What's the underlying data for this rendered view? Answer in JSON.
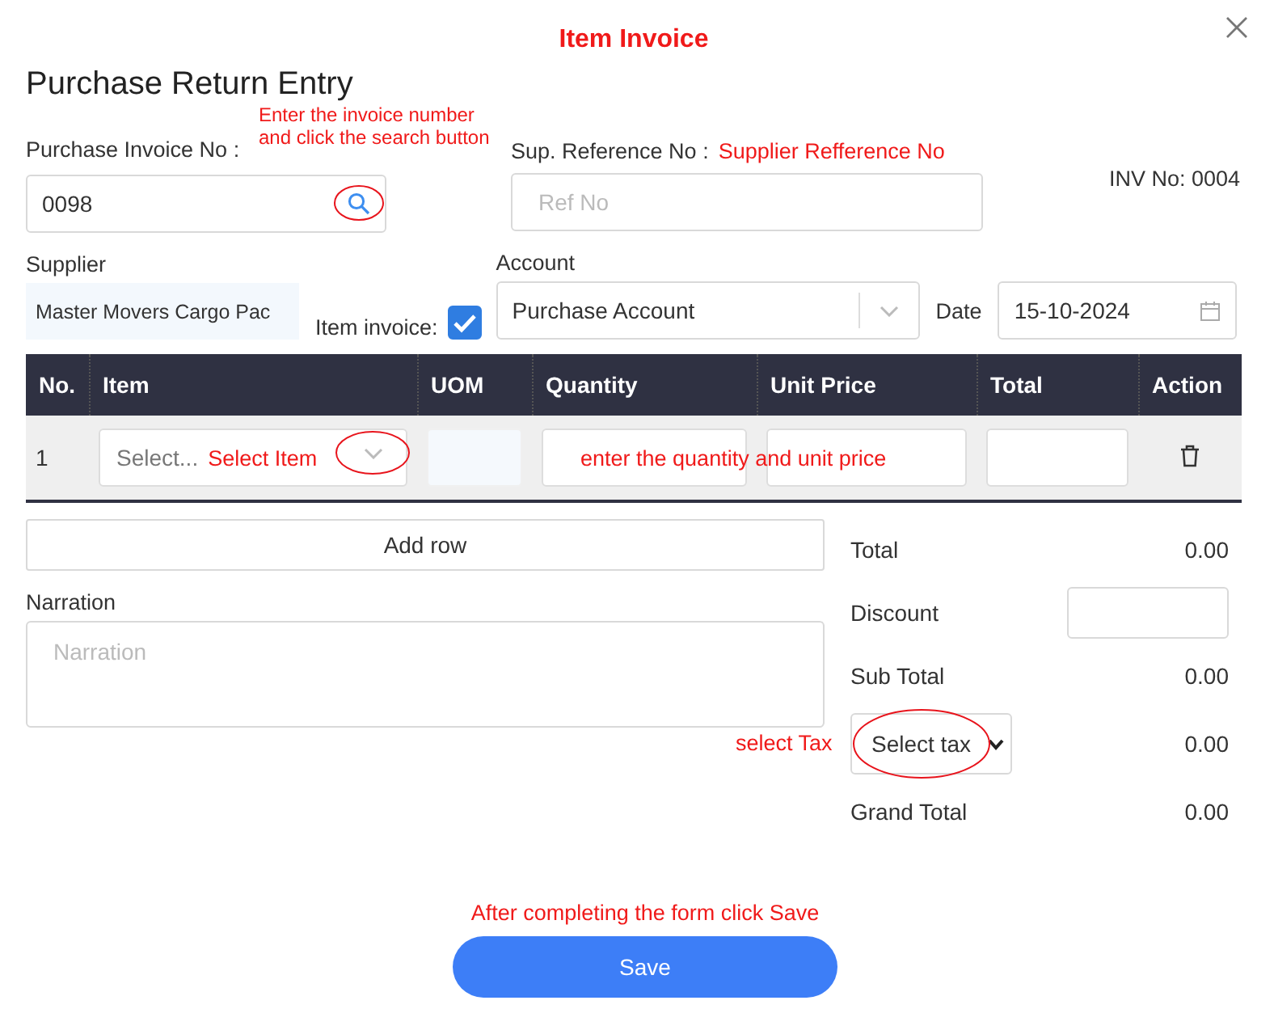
{
  "dialog": {
    "heading": "Item Invoice",
    "title": "Purchase Return Entry"
  },
  "fields": {
    "purchase_invoice_no": {
      "label": "Purchase Invoice No :",
      "value": "0098"
    },
    "sup_reference_no": {
      "label": "Sup. Reference No :",
      "placeholder": "Ref No"
    },
    "inv_no": "INV No: 0004",
    "supplier": {
      "label": "Supplier",
      "value": "Master Movers Cargo Pac"
    },
    "item_invoice": {
      "label": "Item invoice:",
      "checked": true
    },
    "account": {
      "label": "Account",
      "value": "Purchase Account"
    },
    "date": {
      "label": "Date",
      "value": "15-10-2024"
    }
  },
  "table": {
    "columns": [
      "No.",
      "Item",
      "UOM",
      "Quantity",
      "Unit Price",
      "Total",
      "Action"
    ],
    "rows": [
      {
        "no": "1",
        "item_placeholder": "Select..."
      }
    ]
  },
  "add_row": "Add row",
  "narration": {
    "label": "Narration",
    "placeholder": "Narration"
  },
  "summary": [
    {
      "kind": "value",
      "label": "Total",
      "value": "0.00"
    },
    {
      "kind": "input",
      "label": "Discount"
    },
    {
      "kind": "value",
      "label": "Sub Total",
      "value": "0.00"
    },
    {
      "kind": "select",
      "placeholder": "Select tax",
      "value": "0.00"
    },
    {
      "kind": "value",
      "label": "Grand Total",
      "value": "0.00"
    }
  ],
  "save": "Save",
  "annotations": {
    "invoice_search": "Enter the invoice number and click the search button",
    "supplier_reference": "Supplier Refference No",
    "item": "Select Item",
    "quantity_price": "enter the quantity and unit price",
    "tax": "select Tax",
    "save": "After completing the form click Save"
  }
}
